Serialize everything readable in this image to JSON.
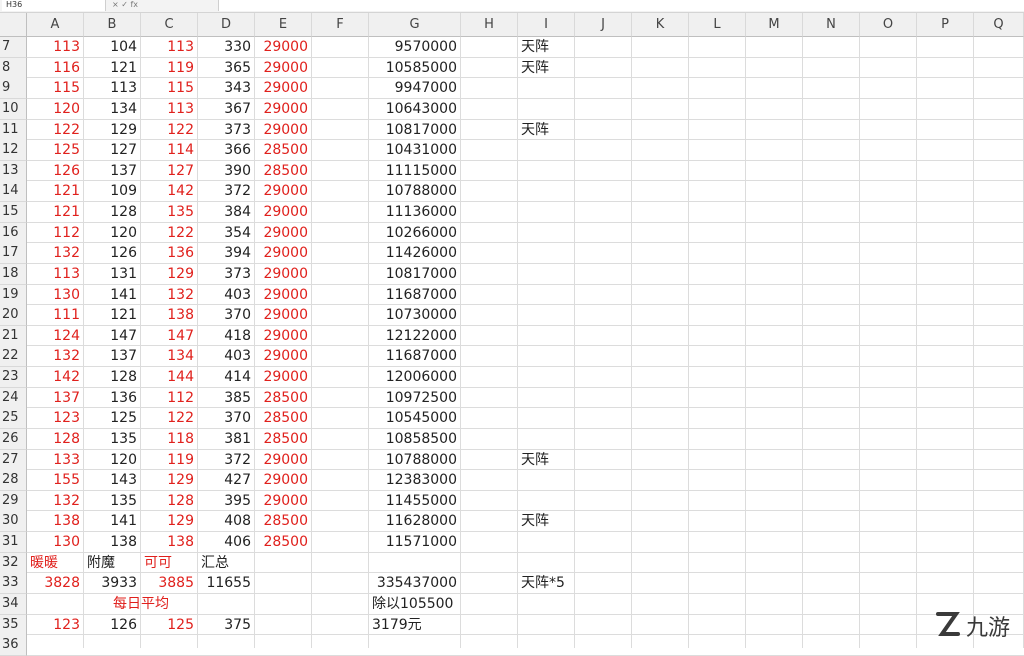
{
  "formula_bar": {
    "name_box": "H36",
    "fx_buttons": "×  ✓  fx"
  },
  "columns": [
    "A",
    "B",
    "C",
    "D",
    "E",
    "F",
    "G",
    "H",
    "I",
    "J",
    "K",
    "L",
    "M",
    "N",
    "O",
    "P",
    "Q"
  ],
  "rows": [
    {
      "n": "7",
      "A": "113",
      "B": "104",
      "C": "113",
      "D": "330",
      "E": "29000",
      "G": "9570000",
      "I": "天阵"
    },
    {
      "n": "8",
      "A": "116",
      "B": "121",
      "C": "119",
      "D": "365",
      "E": "29000",
      "G": "10585000",
      "I": "天阵"
    },
    {
      "n": "9",
      "A": "115",
      "B": "113",
      "C": "115",
      "D": "343",
      "E": "29000",
      "G": "9947000",
      "I": ""
    },
    {
      "n": "10",
      "A": "120",
      "B": "134",
      "C": "113",
      "D": "367",
      "E": "29000",
      "G": "10643000",
      "I": ""
    },
    {
      "n": "11",
      "A": "122",
      "B": "129",
      "C": "122",
      "D": "373",
      "E": "29000",
      "G": "10817000",
      "I": "天阵"
    },
    {
      "n": "12",
      "A": "125",
      "B": "127",
      "C": "114",
      "D": "366",
      "E": "28500",
      "G": "10431000",
      "I": ""
    },
    {
      "n": "13",
      "A": "126",
      "B": "137",
      "C": "127",
      "D": "390",
      "E": "28500",
      "G": "11115000",
      "I": ""
    },
    {
      "n": "14",
      "A": "121",
      "B": "109",
      "C": "142",
      "D": "372",
      "E": "29000",
      "G": "10788000",
      "I": ""
    },
    {
      "n": "15",
      "A": "121",
      "B": "128",
      "C": "135",
      "D": "384",
      "E": "29000",
      "G": "11136000",
      "I": ""
    },
    {
      "n": "16",
      "A": "112",
      "B": "120",
      "C": "122",
      "D": "354",
      "E": "29000",
      "G": "10266000",
      "I": ""
    },
    {
      "n": "17",
      "A": "132",
      "B": "126",
      "C": "136",
      "D": "394",
      "E": "29000",
      "G": "11426000",
      "I": ""
    },
    {
      "n": "18",
      "A": "113",
      "B": "131",
      "C": "129",
      "D": "373",
      "E": "29000",
      "G": "10817000",
      "I": ""
    },
    {
      "n": "19",
      "A": "130",
      "B": "141",
      "C": "132",
      "D": "403",
      "E": "29000",
      "G": "11687000",
      "I": ""
    },
    {
      "n": "20",
      "A": "111",
      "B": "121",
      "C": "138",
      "D": "370",
      "E": "29000",
      "G": "10730000",
      "I": ""
    },
    {
      "n": "21",
      "A": "124",
      "B": "147",
      "C": "147",
      "D": "418",
      "E": "29000",
      "G": "12122000",
      "I": ""
    },
    {
      "n": "22",
      "A": "132",
      "B": "137",
      "C": "134",
      "D": "403",
      "E": "29000",
      "G": "11687000",
      "I": ""
    },
    {
      "n": "23",
      "A": "142",
      "B": "128",
      "C": "144",
      "D": "414",
      "E": "29000",
      "G": "12006000",
      "I": ""
    },
    {
      "n": "24",
      "A": "137",
      "B": "136",
      "C": "112",
      "D": "385",
      "E": "28500",
      "G": "10972500",
      "I": ""
    },
    {
      "n": "25",
      "A": "123",
      "B": "125",
      "C": "122",
      "D": "370",
      "E": "28500",
      "G": "10545000",
      "I": ""
    },
    {
      "n": "26",
      "A": "128",
      "B": "135",
      "C": "118",
      "D": "381",
      "E": "28500",
      "G": "10858500",
      "I": ""
    },
    {
      "n": "27",
      "A": "133",
      "B": "120",
      "C": "119",
      "D": "372",
      "E": "29000",
      "G": "10788000",
      "I": "天阵"
    },
    {
      "n": "28",
      "A": "155",
      "B": "143",
      "C": "129",
      "D": "427",
      "E": "29000",
      "G": "12383000",
      "I": ""
    },
    {
      "n": "29",
      "A": "132",
      "B": "135",
      "C": "128",
      "D": "395",
      "E": "29000",
      "G": "11455000",
      "I": ""
    },
    {
      "n": "30",
      "A": "138",
      "B": "141",
      "C": "129",
      "D": "408",
      "E": "28500",
      "G": "11628000",
      "I": "天阵"
    },
    {
      "n": "31",
      "A": "130",
      "B": "138",
      "C": "138",
      "D": "406",
      "E": "28500",
      "G": "11571000",
      "I": ""
    }
  ],
  "summary": {
    "r32": {
      "n": "32",
      "A": "暖暖",
      "B": "附魔",
      "C": "可可",
      "D": "汇总"
    },
    "r33": {
      "n": "33",
      "A": "3828",
      "B": "3933",
      "C": "3885",
      "D": "11655",
      "G": "335437000",
      "I": "天阵*5"
    },
    "r34": {
      "n": "34",
      "B": "每日平均",
      "G": "除以105500"
    },
    "r35": {
      "n": "35",
      "A": "123",
      "B": "126",
      "C": "125",
      "D": "375",
      "G": "3179元"
    },
    "r36": {
      "n": "36"
    }
  },
  "colors": {
    "red_text": "#e0201c",
    "grid": "#dcdcdc",
    "header_bg": "#f0f0f0"
  },
  "watermark": {
    "icon": "nine-game-logo-icon",
    "text": "九游"
  }
}
